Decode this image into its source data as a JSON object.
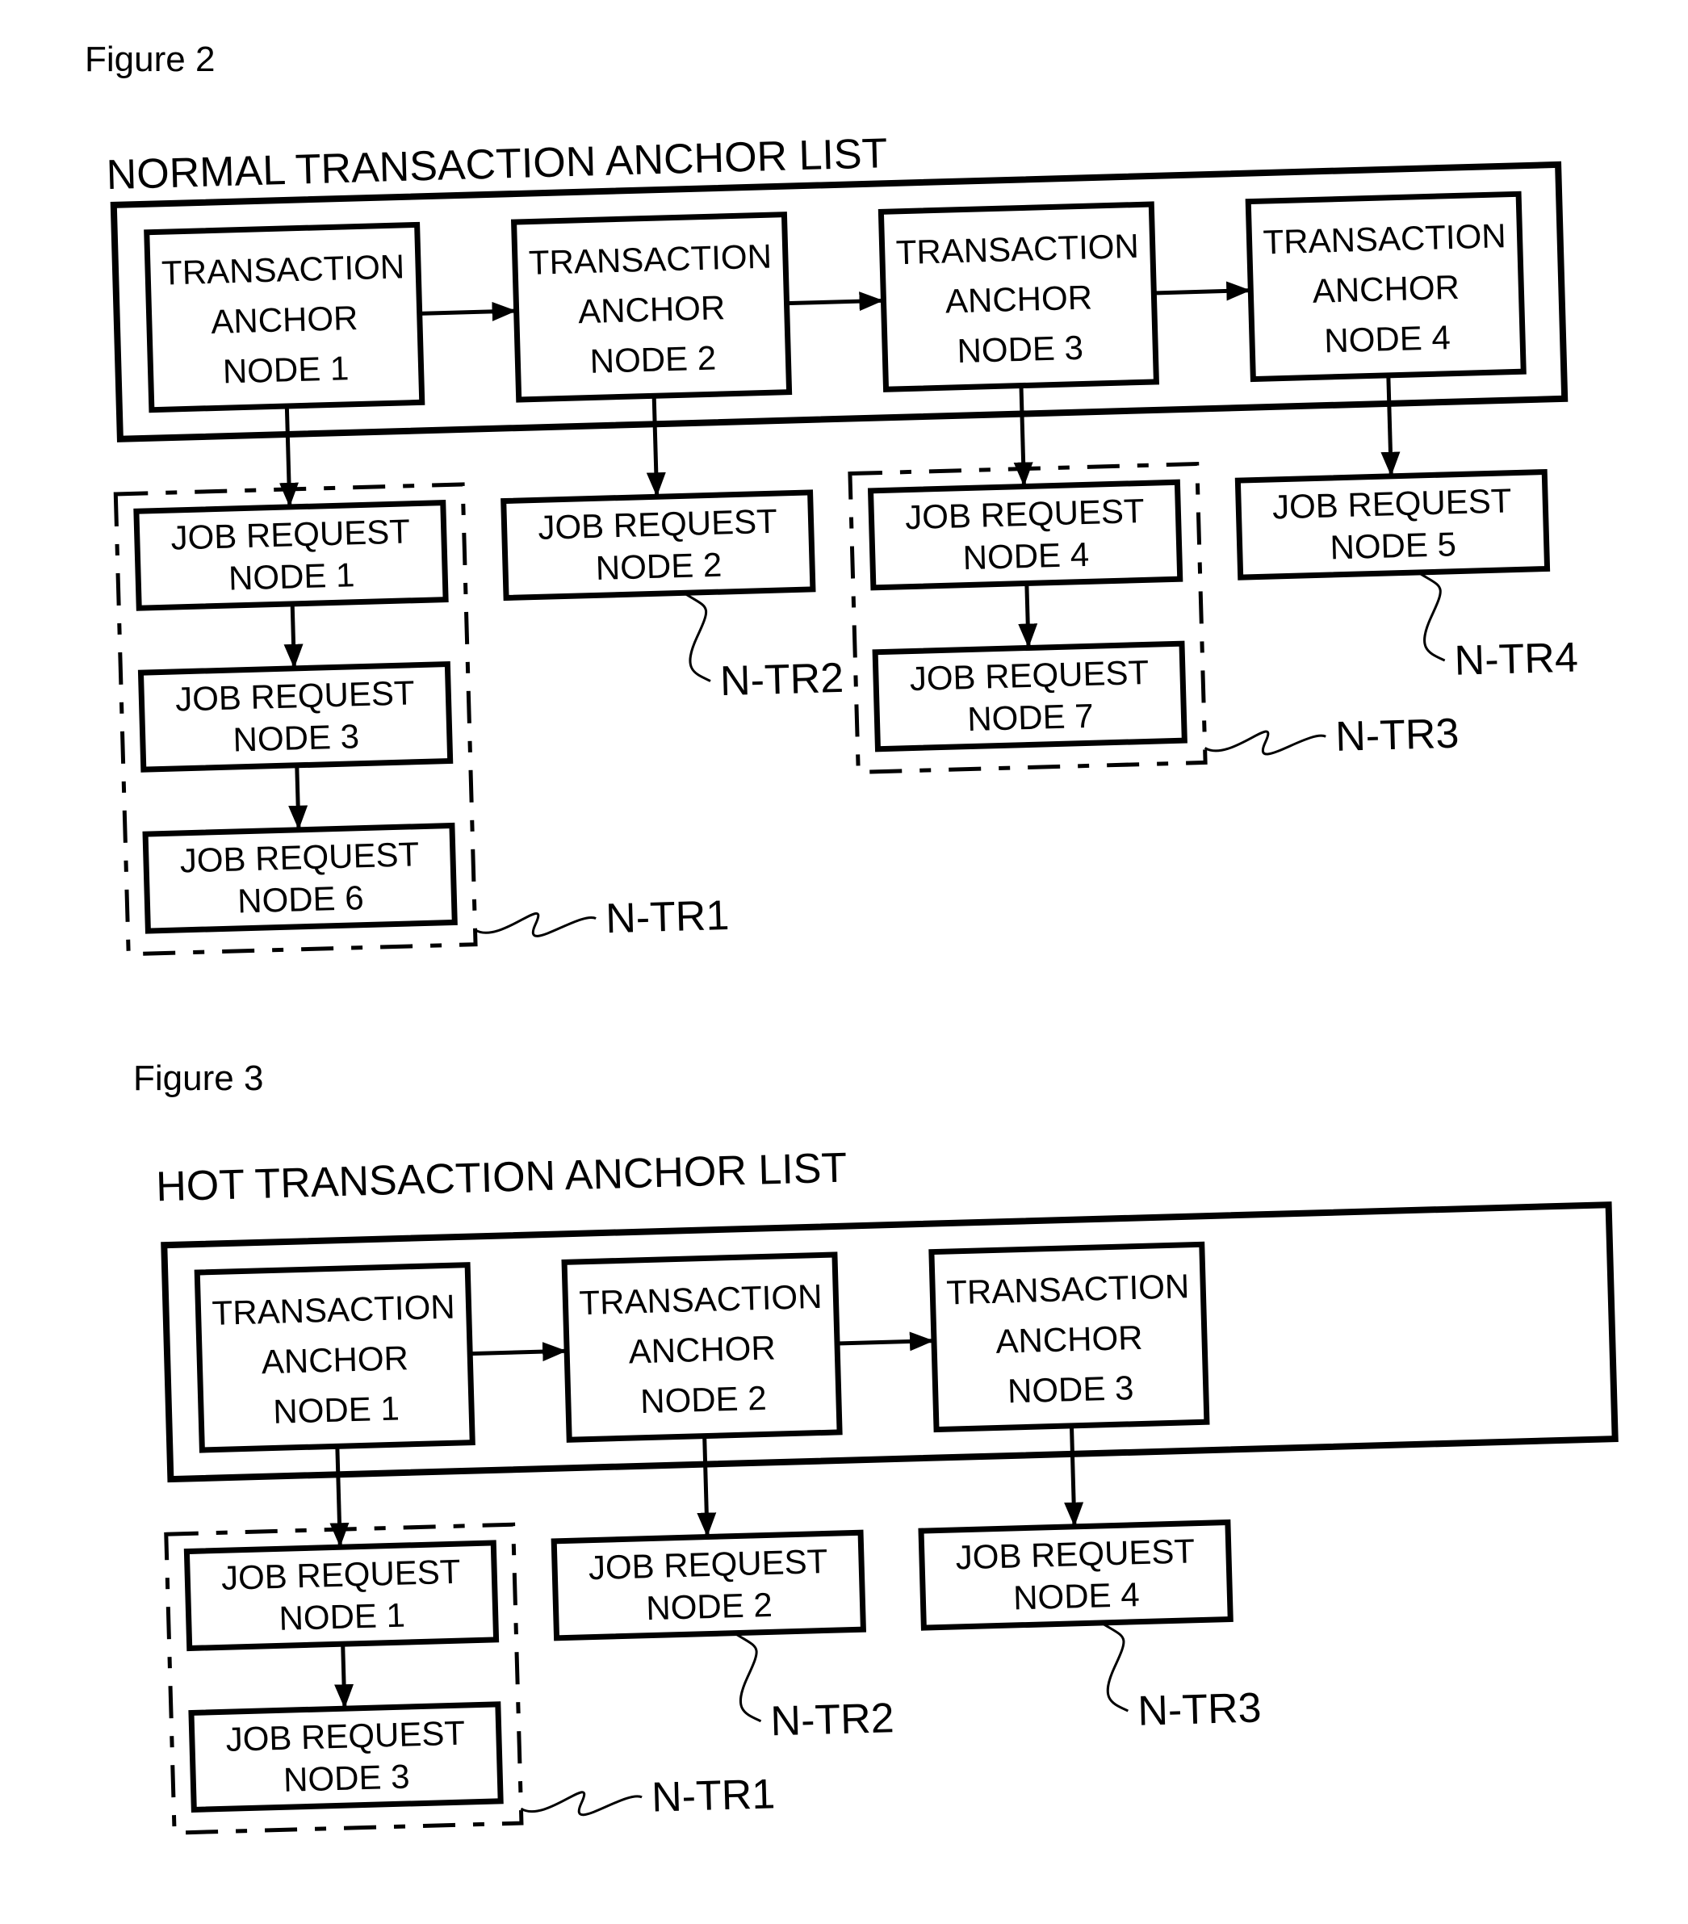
{
  "figures": [
    {
      "id": "fig2",
      "figure_label": "Figure 2",
      "list_title": "NORMAL TRANSACTION ANCHOR LIST",
      "anchors": [
        {
          "lines": [
            "TRANSACTION",
            "ANCHOR",
            "NODE 1"
          ]
        },
        {
          "lines": [
            "TRANSACTION",
            "ANCHOR",
            "NODE 2"
          ]
        },
        {
          "lines": [
            "TRANSACTION",
            "ANCHOR",
            "NODE 3"
          ]
        },
        {
          "lines": [
            "TRANSACTION",
            "ANCHOR",
            "NODE 4"
          ]
        }
      ],
      "job_chains": [
        {
          "anchor": 0,
          "ref": "N-TR1",
          "grouped": true,
          "jobs": [
            {
              "lines": [
                "JOB REQUEST",
                "NODE 1"
              ]
            },
            {
              "lines": [
                "JOB REQUEST",
                "NODE 3"
              ]
            },
            {
              "lines": [
                "JOB REQUEST",
                "NODE 6"
              ]
            }
          ]
        },
        {
          "anchor": 1,
          "ref": "N-TR2",
          "grouped": false,
          "jobs": [
            {
              "lines": [
                "JOB REQUEST",
                "NODE 2"
              ]
            }
          ]
        },
        {
          "anchor": 2,
          "ref": "N-TR3",
          "grouped": true,
          "jobs": [
            {
              "lines": [
                "JOB REQUEST",
                "NODE 4"
              ]
            },
            {
              "lines": [
                "JOB REQUEST",
                "NODE 7"
              ]
            }
          ]
        },
        {
          "anchor": 3,
          "ref": "N-TR4",
          "grouped": false,
          "jobs": [
            {
              "lines": [
                "JOB REQUEST",
                "NODE 5"
              ]
            }
          ]
        }
      ]
    },
    {
      "id": "fig3",
      "figure_label": "Figure 3",
      "list_title": "HOT TRANSACTION ANCHOR LIST",
      "anchors": [
        {
          "lines": [
            "TRANSACTION",
            "ANCHOR",
            "NODE 1"
          ]
        },
        {
          "lines": [
            "TRANSACTION",
            "ANCHOR",
            "NODE 2"
          ]
        },
        {
          "lines": [
            "TRANSACTION",
            "ANCHOR",
            "NODE 3"
          ]
        }
      ],
      "job_chains": [
        {
          "anchor": 0,
          "ref": "N-TR1",
          "grouped": true,
          "jobs": [
            {
              "lines": [
                "JOB REQUEST",
                "NODE 1"
              ]
            },
            {
              "lines": [
                "JOB REQUEST",
                "NODE 3"
              ]
            }
          ]
        },
        {
          "anchor": 1,
          "ref": "N-TR2",
          "grouped": false,
          "jobs": [
            {
              "lines": [
                "JOB REQUEST",
                "NODE 2"
              ]
            }
          ]
        },
        {
          "anchor": 2,
          "ref": "N-TR3",
          "grouped": false,
          "jobs": [
            {
              "lines": [
                "JOB REQUEST",
                "NODE 4"
              ]
            }
          ]
        }
      ]
    }
  ]
}
